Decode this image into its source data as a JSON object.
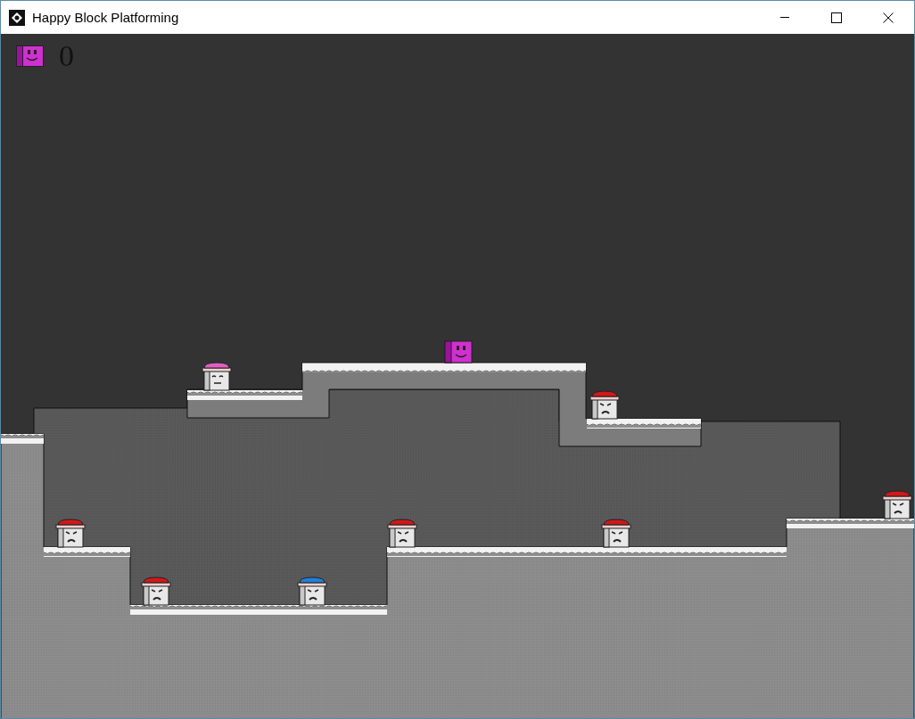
{
  "window": {
    "title": "Happy Block Platforming"
  },
  "hud": {
    "score": "0"
  },
  "npcs": [
    {
      "color": "#e060c0",
      "happy": true
    },
    {
      "color": "#d01818",
      "happy": false
    },
    {
      "color": "#d01818",
      "happy": false
    },
    {
      "color": "#d01818",
      "happy": false
    },
    {
      "color": "#2080d8",
      "happy": false
    },
    {
      "color": "#d01818",
      "happy": false
    },
    {
      "color": "#d01818",
      "happy": false
    },
    {
      "color": "#d01818",
      "happy": false
    }
  ]
}
